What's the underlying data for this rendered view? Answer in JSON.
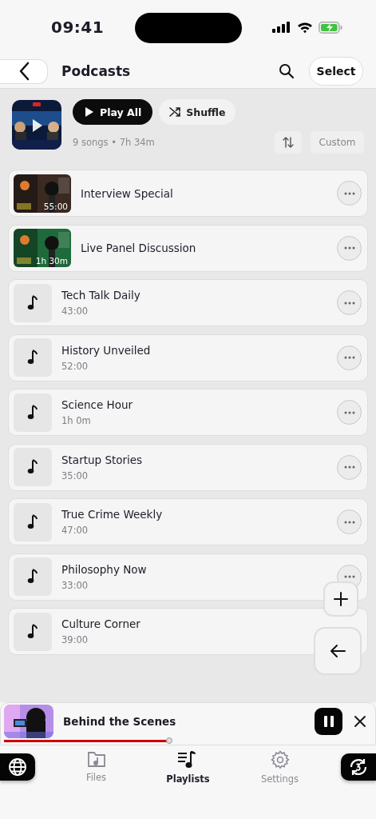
{
  "status_bar": {
    "time": "09:41"
  },
  "nav": {
    "title": "Podcasts",
    "select_label": "Select"
  },
  "playlist": {
    "play_all": "Play All",
    "shuffle": "Shuffle",
    "summary": "9 songs • 7h 34m",
    "sort_label": "Custom"
  },
  "tracks": [
    {
      "kind": "video",
      "title": "Interview Special",
      "duration": "55:00"
    },
    {
      "kind": "video",
      "title": "Live Panel Discussion",
      "duration": "1h 30m"
    },
    {
      "kind": "audio",
      "title": "Tech Talk Daily",
      "duration": "43:00"
    },
    {
      "kind": "audio",
      "title": "History Unveiled",
      "duration": "52:00"
    },
    {
      "kind": "audio",
      "title": "Science Hour",
      "duration": "1h 0m"
    },
    {
      "kind": "audio",
      "title": "Startup Stories",
      "duration": "35:00"
    },
    {
      "kind": "audio",
      "title": "True Crime Weekly",
      "duration": "47:00"
    },
    {
      "kind": "audio",
      "title": "Philosophy Now",
      "duration": "33:00"
    },
    {
      "kind": "audio",
      "title": "Culture Corner",
      "duration": "39:00"
    }
  ],
  "mini_player": {
    "title": "Behind the Scenes",
    "level": 0.45,
    "playing": true
  },
  "tabs": [
    {
      "label": "Files",
      "selected": false
    },
    {
      "label": "Playlists",
      "selected": true
    },
    {
      "label": "Settings",
      "selected": false
    }
  ]
}
